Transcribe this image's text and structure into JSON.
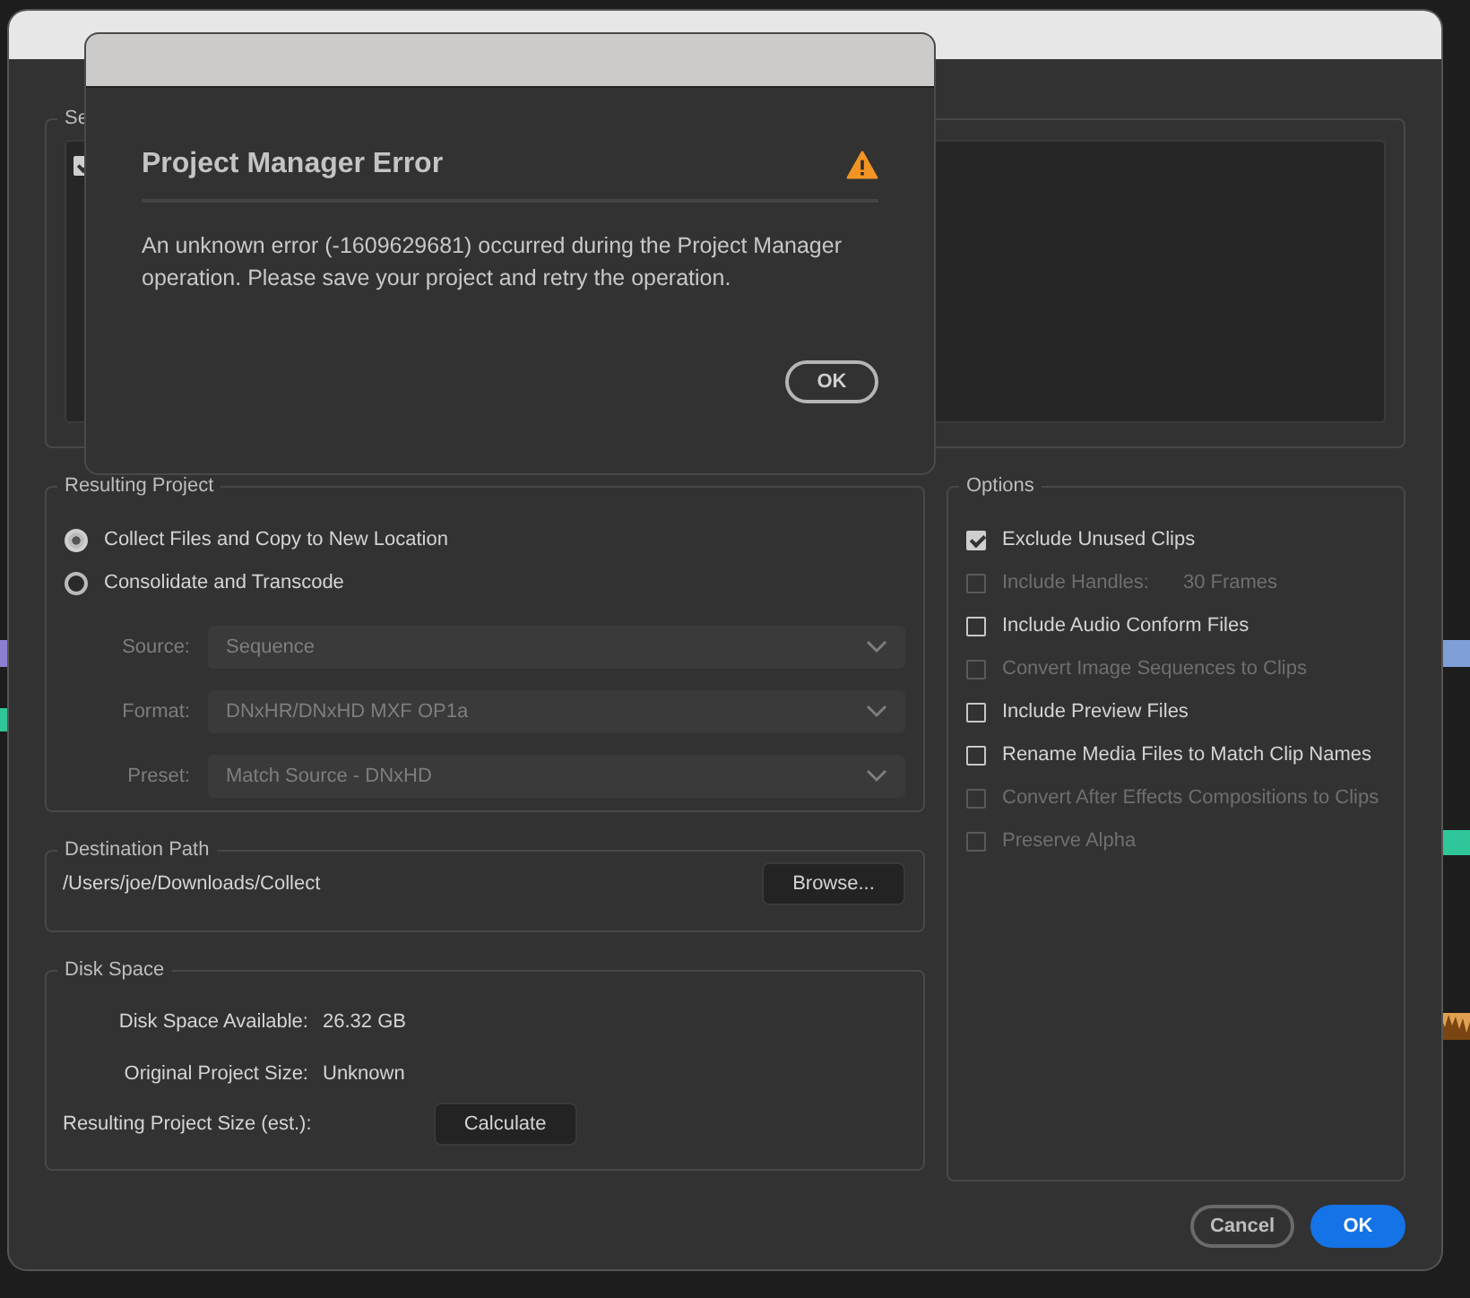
{
  "sequence_panel": {
    "label": "Se",
    "checked": true
  },
  "resulting_project": {
    "label": "Resulting Project",
    "choices": [
      {
        "label": "Collect Files and Copy to New Location",
        "selected": true
      },
      {
        "label": "Consolidate and Transcode",
        "selected": false
      }
    ],
    "dropdowns": [
      {
        "label": "Source:",
        "value": "Sequence",
        "disabled": true
      },
      {
        "label": "Format:",
        "value": "DNxHR/DNxHD MXF OP1a",
        "disabled": true
      },
      {
        "label": "Preset:",
        "value": "Match Source - DNxHD",
        "disabled": true
      }
    ]
  },
  "options": {
    "label": "Options",
    "items": [
      {
        "label": "Exclude Unused Clips",
        "checked": true,
        "disabled": false
      },
      {
        "label": "Include Handles:",
        "value": "30 Frames",
        "checked": false,
        "disabled": true
      },
      {
        "label": "Include Audio Conform Files",
        "checked": false,
        "disabled": false
      },
      {
        "label": "Convert Image Sequences to Clips",
        "checked": false,
        "disabled": true
      },
      {
        "label": "Include Preview Files",
        "checked": false,
        "disabled": false
      },
      {
        "label": "Rename Media Files to Match Clip Names",
        "checked": false,
        "disabled": false
      },
      {
        "label": "Convert After Effects Compositions to Clips",
        "checked": false,
        "disabled": true
      },
      {
        "label": "Preserve Alpha",
        "checked": false,
        "disabled": true
      }
    ]
  },
  "destination": {
    "label": "Destination Path",
    "path": "/Users/joe/Downloads/Collect",
    "button": "Browse..."
  },
  "disk_space": {
    "label": "Disk Space",
    "rows": [
      {
        "label": "Disk Space Available:",
        "value": "26.32 GB"
      },
      {
        "label": "Original Project Size:",
        "value": "Unknown"
      }
    ],
    "estimate_label": "Resulting Project Size (est.):",
    "button": "Calculate"
  },
  "buttons": [
    {
      "label": "Cancel",
      "kind": "secondary"
    },
    {
      "label": "OK",
      "kind": "primary"
    }
  ],
  "error_dialog": {
    "title": "Project Manager Error",
    "message": "An unknown error (-1609629681) occurred during the Project Manager operation. Please save your project and retry the operation.",
    "button": "OK"
  }
}
